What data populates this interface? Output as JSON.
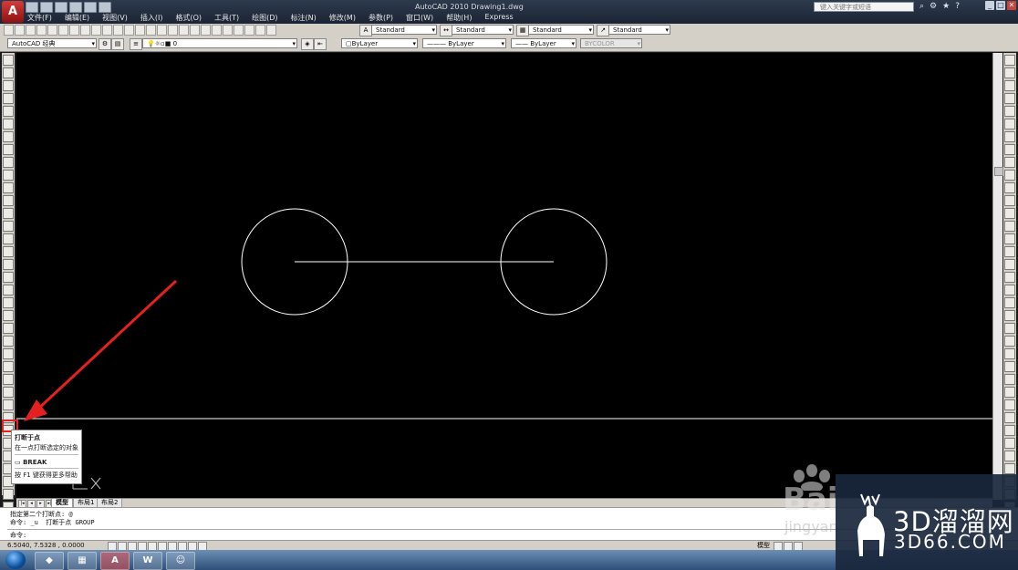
{
  "window": {
    "app_button": "A",
    "title": "AutoCAD 2010   Drawing1.dwg",
    "search_placeholder": "键入关键字或短语",
    "controls": [
      "_",
      "□",
      "✕"
    ]
  },
  "menu": [
    "文件(F)",
    "编辑(E)",
    "视图(V)",
    "插入(I)",
    "格式(O)",
    "工具(T)",
    "绘图(D)",
    "标注(N)",
    "修改(M)",
    "参数(P)",
    "窗口(W)",
    "帮助(H)",
    "Express"
  ],
  "styles_toolbar": {
    "text_style": "Standard",
    "dim_style": "Standard",
    "table_style": "Standard",
    "multileader_style": "Standard"
  },
  "layers_toolbar": {
    "workspace": "AutoCAD 经典",
    "layer": "0",
    "color": "ByLayer",
    "linetype": "ByLayer",
    "lineweight": "ByLayer",
    "plotstyle": "BYCOLOR"
  },
  "drawing": {
    "background": "#000000",
    "stroke": "#ffffff",
    "objects": [
      "circle",
      "line",
      "circle",
      "crosshair-horizontal"
    ]
  },
  "tooltip": {
    "title": "打断于点",
    "description": "在一点打断选定的对象",
    "command": "BREAK",
    "help": "按 F1 键获得更多帮助"
  },
  "layout_tabs": [
    "模型",
    "布局1",
    "布局2"
  ],
  "command_lines": [
    "指定第二个打断点: @",
    "命令: _u  打断于点 GROUP",
    "命令:"
  ],
  "status": {
    "coords": "6.5040,  7.5328 , 0.0000",
    "model_label": "模型"
  },
  "taskbar": {
    "apps": [
      "360",
      "calc",
      "AutoCAD",
      "W",
      "WeChat"
    ],
    "highlight_color": "#e52020"
  },
  "watermarks": {
    "baidu": "Bai",
    "baidu_sub": "jingyan",
    "brand_cn": "3D溜溜网",
    "brand_domain": "3D66.COM"
  }
}
